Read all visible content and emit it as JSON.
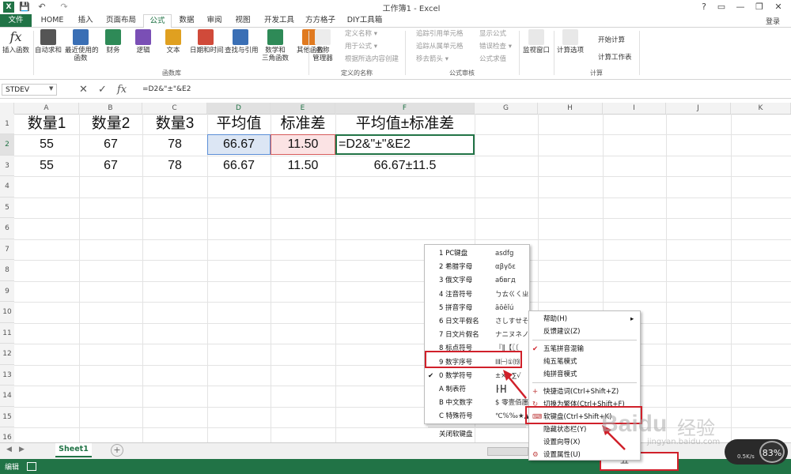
{
  "app": {
    "title": "工作簿1 - Excel",
    "login": "登录",
    "quick_access": [
      "💾",
      "↶",
      "↷"
    ]
  },
  "tabs": [
    "文件",
    "HOME",
    "插入",
    "页面布局",
    "公式",
    "数据",
    "审阅",
    "视图",
    "开发工具",
    "方方格子",
    "DIY工具箱"
  ],
  "active_tab": "公式",
  "ribbon": {
    "insert_func": "插入函数",
    "library": [
      {
        "label": "自动求和",
        "color": "#555555"
      },
      {
        "label": "最近使用的\n函数",
        "color": "#3a6fb5"
      },
      {
        "label": "财务",
        "color": "#2e8a57"
      },
      {
        "label": "逻辑",
        "color": "#7a4fb5"
      },
      {
        "label": "文本",
        "color": "#e0a020"
      },
      {
        "label": "日期和时间",
        "color": "#d04a3a"
      },
      {
        "label": "查找与引用",
        "color": "#3a6fb5"
      },
      {
        "label": "数学和\n三角函数",
        "color": "#2e8a57"
      },
      {
        "label": "其他函数",
        "color": "#e07a20"
      }
    ],
    "group_library": "函数库",
    "name_mgr": "名称\n管理器",
    "names_small": [
      "定义名称 ▾",
      "用于公式 ▾",
      "根据所选内容创建"
    ],
    "group_names": "定义的名称",
    "audit_small": [
      "追踪引用单元格",
      "追踪从属单元格",
      "移去箭头 ▾",
      "显示公式",
      "错误检查 ▾",
      "公式求值"
    ],
    "group_audit": "公式审核",
    "watch": "监视窗口",
    "calc_options": "计算选项",
    "calc_small": [
      "开始计算",
      "计算工作表"
    ],
    "group_calc": "计算"
  },
  "formula_bar": {
    "namebox": "STDEV",
    "formula": "=D2&\"±\"&E2",
    "icons": [
      "✕",
      "✓",
      "fx"
    ]
  },
  "grid": {
    "columns": [
      "A",
      "B",
      "C",
      "D",
      "E",
      "F",
      "G",
      "H",
      "I",
      "J",
      "K"
    ],
    "rows": [
      "1",
      "2",
      "3",
      "4",
      "5",
      "6",
      "7",
      "8",
      "9",
      "10",
      "11",
      "12",
      "13",
      "14",
      "15",
      "16"
    ],
    "headers": [
      "数量1",
      "数量2",
      "数量3",
      "平均值",
      "标准差",
      "平均值±标准差"
    ],
    "row2": [
      "55",
      "67",
      "78",
      "66.67",
      "11.50",
      "=D2&\"±\"&E2"
    ],
    "row3": [
      "55",
      "67",
      "78",
      "66.67",
      "11.50",
      "66.67±11.5"
    ]
  },
  "sheet": {
    "tab": "Sheet1",
    "add": "+"
  },
  "status": {
    "mode": "编辑"
  },
  "softkeyboard_menu": {
    "items": [
      {
        "label": "1 PC键盘",
        "sample": "asdfg"
      },
      {
        "label": "2 希腊字母",
        "sample": "αβγδε"
      },
      {
        "label": "3 俄文字母",
        "sample": "абвгд"
      },
      {
        "label": "4 注音符号",
        "sample": "ㄅㄊㄍㄑㄓ"
      },
      {
        "label": "5 拼音字母",
        "sample": "āōêǐú"
      },
      {
        "label": "6 日文平假名",
        "sample": "さしすせそ"
      },
      {
        "label": "7 日文片假名",
        "sample": "ナニヌネノ"
      },
      {
        "label": "8 标点符号",
        "sample": "『‖【〖〔"
      },
      {
        "label": "9 数字序号",
        "sample": "ⅠⅡ㈠①⒆"
      },
      {
        "label": "0 数学符号",
        "sample": "±×÷∑√"
      },
      {
        "label": "A 制表符",
        "sample": "┠┣┫"
      },
      {
        "label": "B 中文数字",
        "sample": "$ 零壹佰廛"
      },
      {
        "label": "C 特殊符号",
        "sample": "℃%‰★▲→"
      }
    ],
    "close": "关闭软键盘",
    "checked": "✔"
  },
  "ime_menu": {
    "items": [
      "帮助(H)",
      "反馈建议(Z)",
      "五笔拼音混输",
      "纯五笔模式",
      "纯拼音模式",
      "快捷造词(Ctrl+Shift+Z)",
      "切换为繁体(Ctrl+Shift+F)",
      "软键盘(Ctrl+Shift+K)",
      "隐藏状态栏(Y)",
      "设置向导(X)",
      "设置属性(U)"
    ],
    "checked": "✔",
    "submenu_arrow": "▸"
  },
  "ime_bar": "五",
  "watermark": {
    "brand": "Baidu",
    "cn": "经验",
    "url": "jingyan.baidu.com"
  },
  "net": {
    "percent": "83%",
    "speed": "0.5K/s"
  },
  "colors": {
    "excel_green": "#217346",
    "highlight_red": "#d0202a",
    "sel_blue": "#dce6f4",
    "sel_red": "#fbe3e4"
  }
}
